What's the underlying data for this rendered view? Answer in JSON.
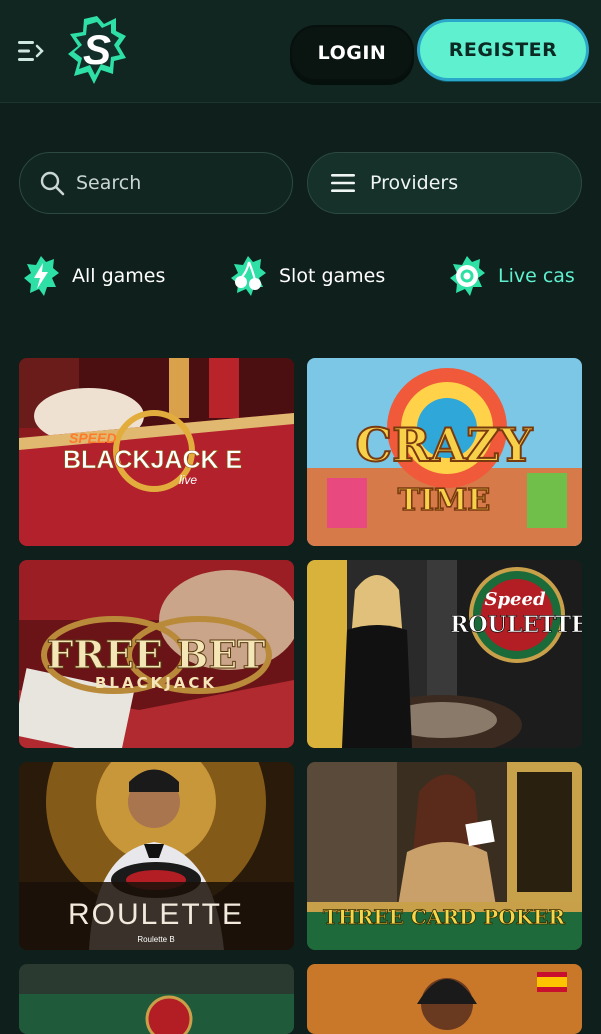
{
  "header": {
    "login_label": "LOGIN",
    "register_label": "REGISTER"
  },
  "search": {
    "placeholder": "Search"
  },
  "providers": {
    "label": "Providers"
  },
  "categories": [
    {
      "label": "All games",
      "icon": "lightning-icon"
    },
    {
      "label": "Slot games",
      "icon": "cherries-icon"
    },
    {
      "label": "Live cas",
      "icon": "chip-icon",
      "active": true
    }
  ],
  "games": [
    {
      "title_line1": "SPEED",
      "title_line2": "BLACKJACK E",
      "title_line3": "live"
    },
    {
      "title_line1": "CRAZY",
      "title_line2": "TIME"
    },
    {
      "title_line1": "FREE BET",
      "title_line2": "BLACKJACK"
    },
    {
      "title_line1": "Speed",
      "title_line2": "ROULETTE"
    },
    {
      "title_line1": "ROULETTE",
      "title_line2": "Roulette B"
    },
    {
      "title_line1": "THREE CARD POKER"
    }
  ],
  "colors": {
    "background": "#0f1f1b",
    "accent": "#5ff0cf",
    "active_category": "#5ff0cf"
  }
}
